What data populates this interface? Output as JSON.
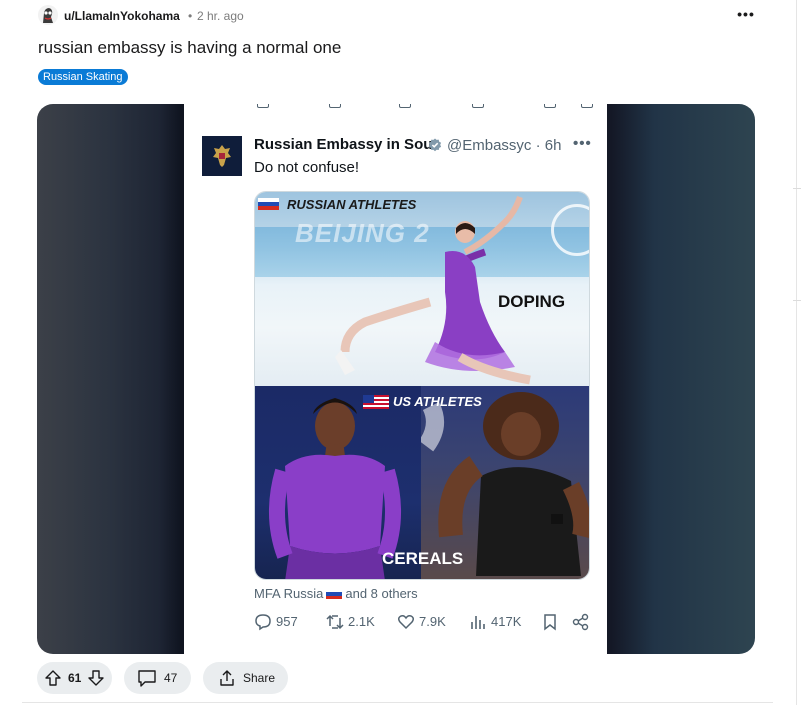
{
  "post": {
    "author": "u/LlamaInYokohama",
    "separator": "•",
    "time": "2 hr. ago",
    "more_label": "•••",
    "title": "russian embassy is having a normal one",
    "flair": "Russian Skating"
  },
  "tweet": {
    "display_name": "Russian Embassy in Sou",
    "handle_time": "@Embassyc · 6h",
    "more_label": "•••",
    "text": "Do not confuse!",
    "image": {
      "top_label": "RUSSIAN ATHLETES",
      "top_caption": "DOPING",
      "backdrop_text": "BEIJING 2",
      "bottom_label": "US ATHLETES",
      "bottom_caption": "CEREALS"
    },
    "meta_prefix": "MFA Russia",
    "meta_suffix": "and 8 others",
    "actions": {
      "replies": "957",
      "reposts": "2.1K",
      "likes": "7.9K",
      "views": "417K"
    }
  },
  "footer": {
    "votes": "61",
    "comments": "47",
    "share_label": "Share"
  },
  "colors": {
    "flair": "#0a7bd6",
    "verified": "#829aab",
    "pill_bg": "#eaedef"
  }
}
